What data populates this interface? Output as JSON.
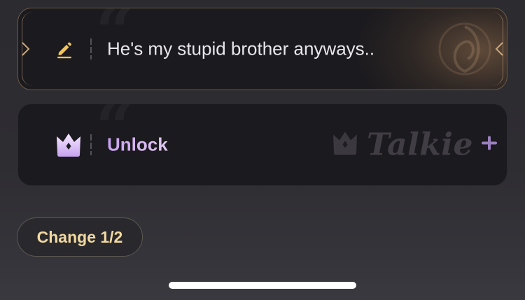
{
  "replies": [
    {
      "text": "He's my stupid brother anyways..",
      "icon": "pencil-icon",
      "selected": true
    },
    {
      "text": "Unlock",
      "icon": "crown-icon",
      "locked": true,
      "brand": {
        "name": "Talkie",
        "icon": "crown-icon",
        "suffix": "plus-icon"
      }
    }
  ],
  "change_button": {
    "label": "Change 1/2"
  },
  "colors": {
    "accent_gold": "#f1d9a0",
    "accent_purple": "#c8a0f0",
    "card_bg": "#1b1a1e",
    "page_bg": "#2e2d32"
  }
}
